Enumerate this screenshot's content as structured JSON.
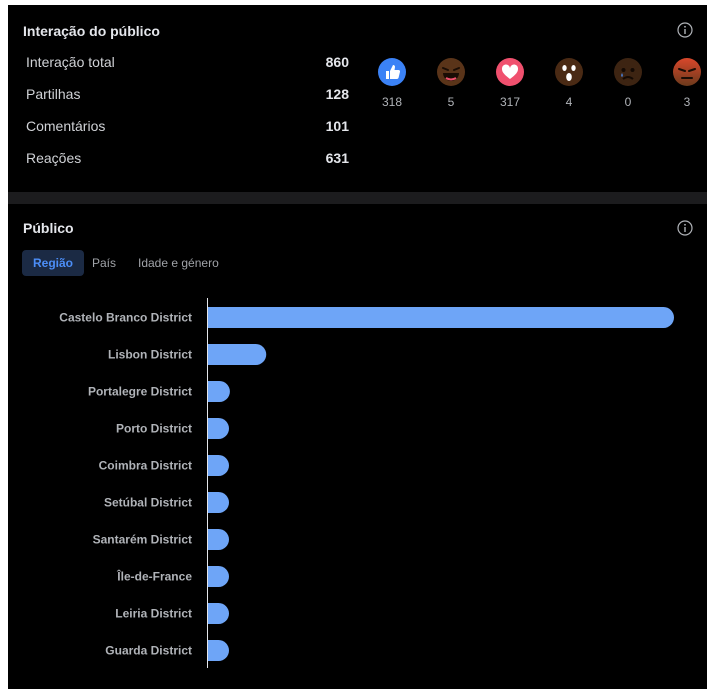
{
  "engagement": {
    "title": "Interação do público",
    "metrics": [
      {
        "label": "Interação total",
        "value": "860"
      },
      {
        "label": "Partilhas",
        "value": "128"
      },
      {
        "label": "Comentários",
        "value": "101"
      },
      {
        "label": "Reações",
        "value": "631"
      }
    ],
    "reactions": [
      {
        "icon": "like-icon",
        "count": "318"
      },
      {
        "icon": "haha-icon",
        "count": "5"
      },
      {
        "icon": "love-icon",
        "count": "317"
      },
      {
        "icon": "wow-icon",
        "count": "4"
      },
      {
        "icon": "sad-icon",
        "count": "0"
      },
      {
        "icon": "angry-icon",
        "count": "3"
      }
    ]
  },
  "audience": {
    "title": "Público",
    "tabs": [
      {
        "label": "Região",
        "active": true
      },
      {
        "label": "País",
        "active": false
      },
      {
        "label": "Idade e género",
        "active": false
      }
    ]
  },
  "colors": {
    "bar": "#6ea5f7",
    "accent": "#4c8ef7",
    "like": "#3b82f6",
    "love": "#f0506e"
  },
  "chart_data": {
    "type": "bar",
    "orientation": "horizontal",
    "categories": [
      "Castelo Branco District",
      "Lisbon District",
      "Portalegre District",
      "Porto District",
      "Coimbra District",
      "Setúbal District",
      "Santarém District",
      "Île-de-France",
      "Leiria District",
      "Guarda District"
    ],
    "values": [
      100,
      12.5,
      4.7,
      4.1,
      4.1,
      3.9,
      3.7,
      3.4,
      3.4,
      2.9
    ],
    "xlim": [
      0,
      100
    ],
    "grid": false,
    "legend": "none"
  }
}
